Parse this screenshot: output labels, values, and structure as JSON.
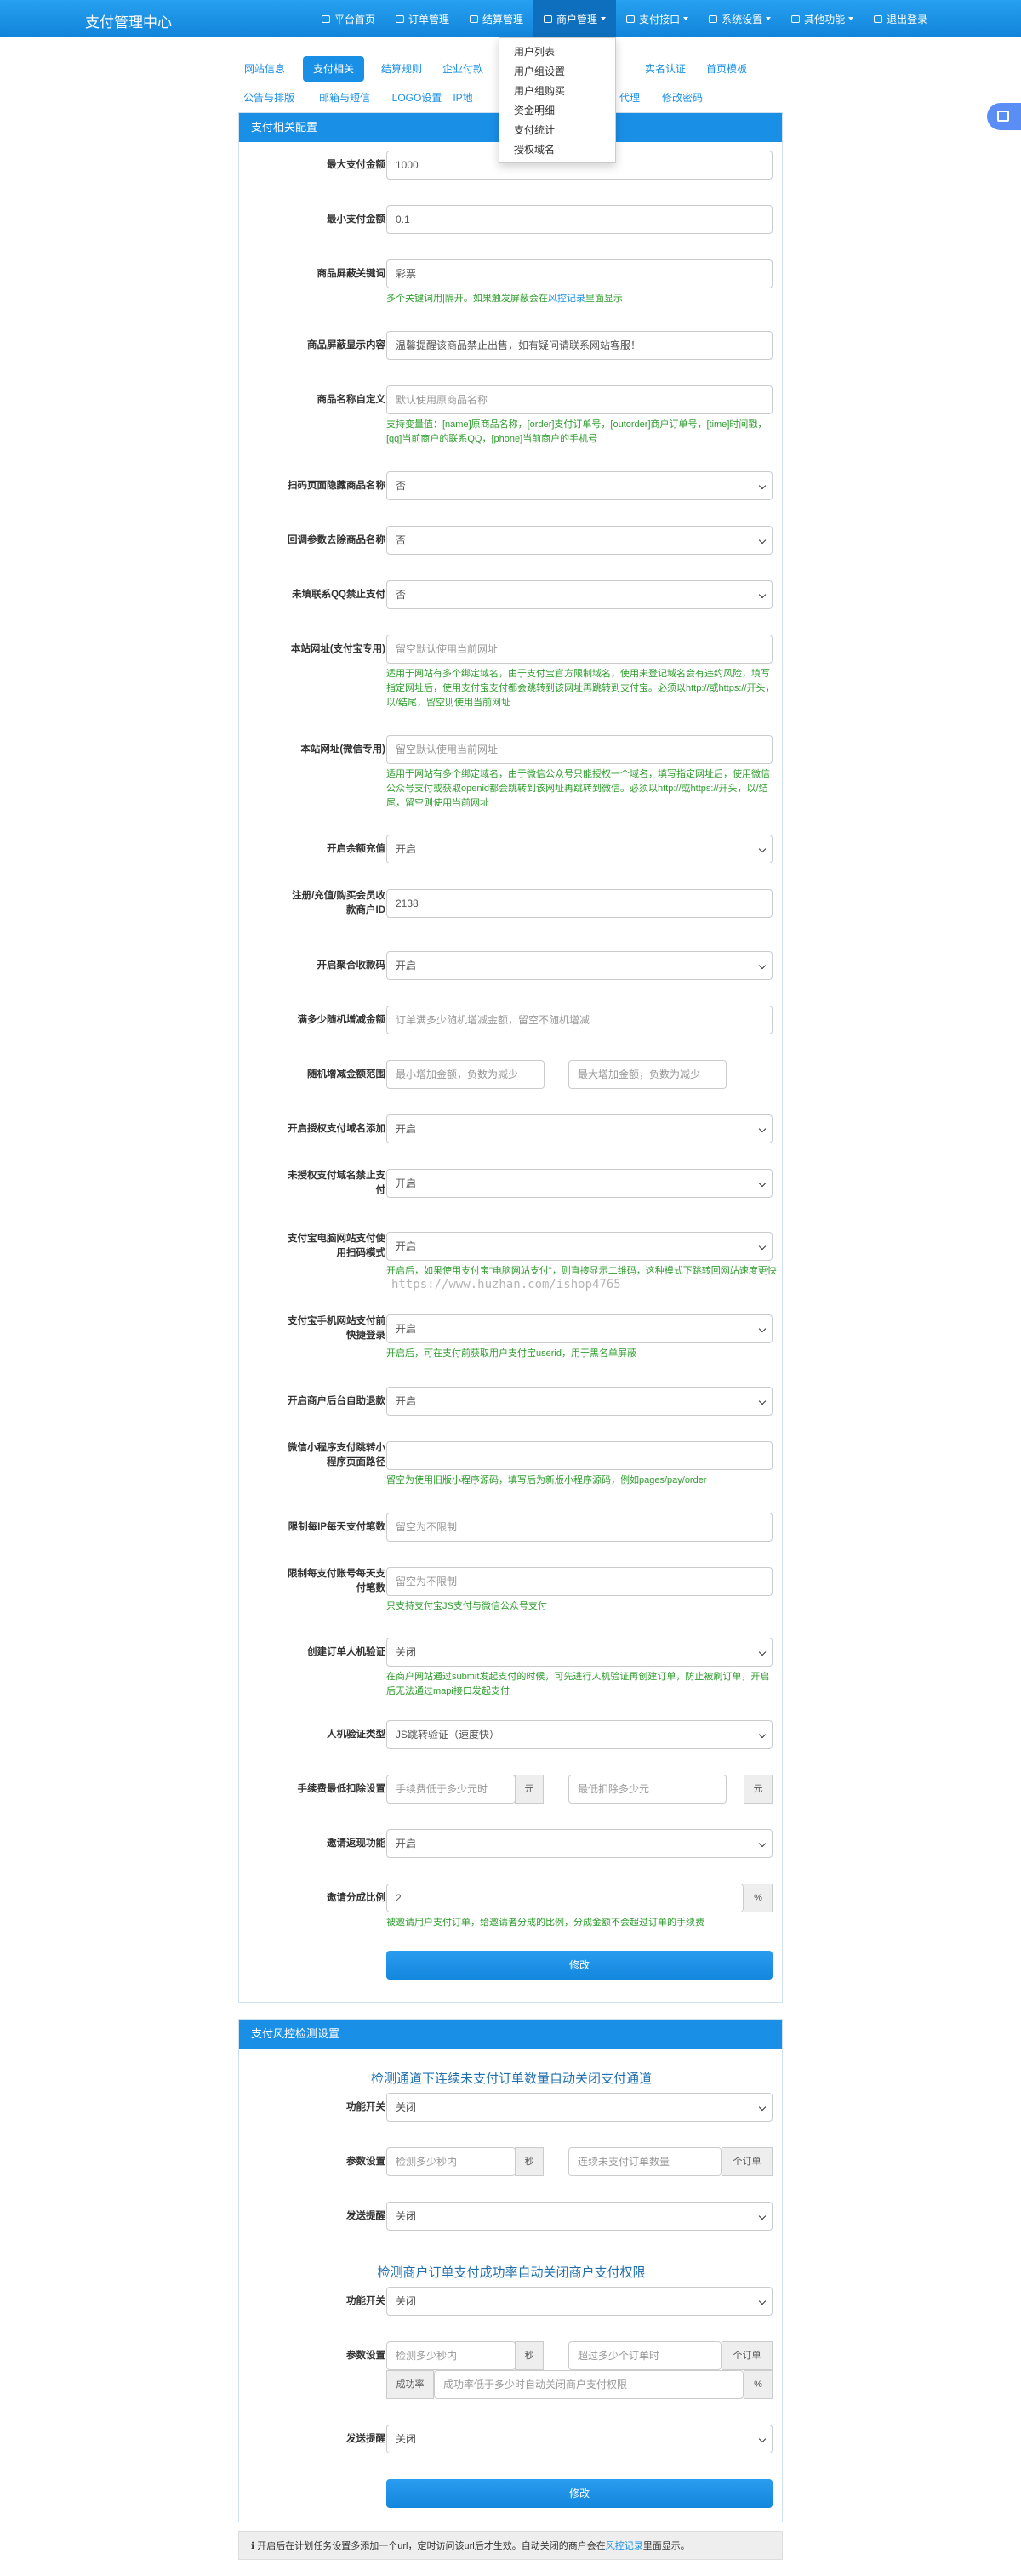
{
  "brand": "支付管理中心",
  "nav": [
    "平台首页",
    "订单管理",
    "结算管理",
    "商户管理",
    "支付接口",
    "系统设置",
    "其他功能",
    "退出登录"
  ],
  "dropdown": [
    "用户列表",
    "用户组设置",
    "用户组购买",
    "资金明细",
    "支付统计",
    "授权域名"
  ],
  "tabs": [
    "网站信息",
    "支付相关",
    "结算规则",
    "企业付款",
    "实名认证",
    "首页模板",
    "公告与排版",
    "邮箱与短信",
    "LOGO设置",
    "IP地",
    "代理",
    "修改密码"
  ],
  "panel1": {
    "title": "支付相关配置",
    "fields": [
      {
        "label": "最大支付金额",
        "value": "1000"
      },
      {
        "label": "最小支付金额",
        "value": "0.1"
      },
      {
        "label": "商品屏蔽关键词",
        "value": "彩票",
        "help": "多个关键词用|隔开。如果触发屏蔽会在",
        "link": "风控记录",
        "help2": "里面显示"
      },
      {
        "label": "商品屏蔽显示内容",
        "value": "温馨提醒该商品禁止出售，如有疑问请联系网站客服！"
      },
      {
        "label": "商品名称自定义",
        "placeholder": "默认使用原商品名称",
        "help": "支持变量值：[name]原商品名称，[order]支付订单号，[outorder]商户订单号，[time]时间戳，[qq]当前商户的联系QQ，[phone]当前商户的手机号"
      },
      {
        "label": "扫码页面隐藏商品名称",
        "value": "否"
      },
      {
        "label": "回调参数去除商品名称",
        "value": "否"
      },
      {
        "label": "未填联系QQ禁止支付",
        "value": "否"
      },
      {
        "label": "本站网址(支付宝专用)",
        "placeholder": "留空默认使用当前网址",
        "help": "适用于网站有多个绑定域名，由于支付宝官方限制域名，使用未登记域名会有违约风险，填写指定网址后，使用支付宝支付都会跳转到该网址再跳转到支付宝。必须以http://或https://开头，以/结尾，留空则使用当前网址"
      },
      {
        "label": "本站网址(微信专用)",
        "placeholder": "留空默认使用当前网址",
        "help": "适用于网站有多个绑定域名，由于微信公众号只能授权一个域名，填写指定网址后，使用微信公众号支付或获取openid都会跳转到该网址再跳转到微信。必须以http://或https://开头，以/结尾，留空则使用当前网址"
      },
      {
        "label": "开启余额充值",
        "value": "开启"
      },
      {
        "label": "注册/充值/购买会员收款商户ID",
        "value": "2138"
      },
      {
        "label": "开启聚合收款码",
        "value": "开启"
      },
      {
        "label": "满多少随机增减金额",
        "placeholder": "订单满多少随机增减金额，留空不随机增减"
      },
      {
        "label": "随机增减金额范围",
        "placeholder": "最小增加金额，负数为减少",
        "placeholder2": "最大增加金额，负数为减少"
      },
      {
        "label": "开启授权支付域名添加",
        "value": "开启"
      },
      {
        "label": "未授权支付域名禁止支付",
        "value": "开启"
      },
      {
        "label": "支付宝电脑网站支付使用扫码模式",
        "value": "开启",
        "help": "开启后，如果使用支付宝\"电脑网站支付\"，则直接显示二维码，这种模式下跳转回网站速度更快"
      },
      {
        "label": "支付宝手机网站支付前快捷登录",
        "value": "开启",
        "help": "开启后，可在支付前获取用户支付宝userid，用于黑名单屏蔽"
      },
      {
        "label": "开启商户后台自助退款",
        "value": "开启"
      },
      {
        "label": "微信小程序支付跳转小程序页面路径",
        "value": "",
        "help": "留空为使用旧版小程序源码，填写后为新版小程序源码，例如pages/pay/order"
      },
      {
        "label": "限制每IP每天支付笔数",
        "placeholder": "留空为不限制"
      },
      {
        "label": "限制每支付账号每天支付笔数",
        "placeholder": "留空为不限制",
        "help": "只支持支付宝JS支付与微信公众号支付"
      },
      {
        "label": "创建订单人机验证",
        "value": "关闭",
        "help": "在商户网站通过submit发起支付的时候，可先进行人机验证再创建订单，防止被刷订单，开启后无法通过mapi接口发起支付"
      },
      {
        "label": "人机验证类型",
        "value": "JS跳转验证（速度快）"
      },
      {
        "label": "手续费最低扣除设置",
        "placeholder": "手续费低于多少元时",
        "unit": "元",
        "placeholder2": "最低扣除多少元",
        "unit2": "元"
      },
      {
        "label": "邀请返现功能",
        "value": "开启"
      },
      {
        "label": "邀请分成比例",
        "value": "2",
        "unit": "%",
        "help": "被邀请用户支付订单，给邀请者分成的比例，分成金额不会超过订单的手续费"
      }
    ],
    "button": "修改"
  },
  "panel2": {
    "title": "支付风控检测设置",
    "section1": "检测通道下连续未支付订单数量自动关闭支付通道",
    "section2": "检测商户订单支付成功率自动关闭商户支付权限",
    "switch_label": "功能开关",
    "switch_value": "关闭",
    "param_label": "参数设置",
    "s1_ph1": "检测多少秒内",
    "s1_unit1": "秒",
    "s1_ph2": "连续未支付订单数量",
    "s1_unit2": "个订单",
    "notify_label": "发送提醒",
    "notify_value": "关闭",
    "s2_ph1": "检测多少秒内",
    "s2_unit1": "秒",
    "s2_ph2": "超过多少个订单时",
    "s2_unit2": "个订单",
    "s2_prefix": "成功率",
    "s2_ph3": "成功率低于多少时自动关闭商户支付权限",
    "s2_unit3": "%",
    "button": "修改"
  },
  "watermark": "https://www.huzhan.com/ishop4765",
  "footer": {
    "text": "开启后在计划任务设置多添加一个url，定时访问该url后才生效。自动关闭的商户会在",
    "link": "风控记录",
    "text2": "里面显示。"
  }
}
